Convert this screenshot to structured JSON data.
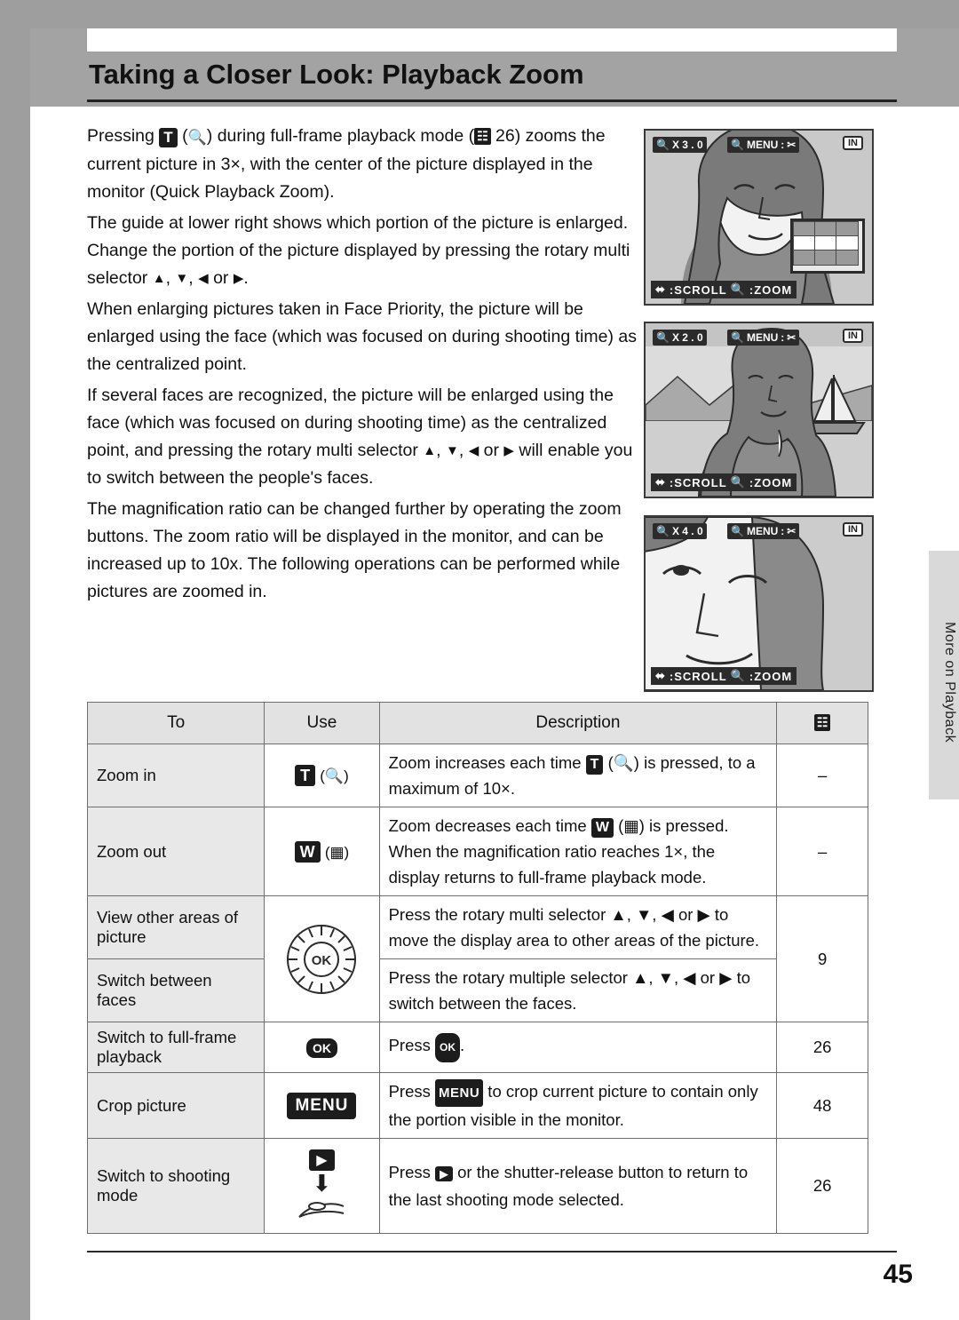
{
  "header": {
    "title": "Taking a Closer Look: Playback Zoom"
  },
  "body": {
    "paragraphs": [
      {
        "id": "p1",
        "segments": [
          {
            "t": "text",
            "v": "Pressing "
          },
          {
            "t": "key",
            "v": "T"
          },
          {
            "t": "text",
            "v": " ("
          },
          {
            "t": "icon",
            "v": "magnifier-plus-icon"
          },
          {
            "t": "text",
            "v": ") during full-frame playback mode ("
          },
          {
            "t": "icon",
            "v": "book-ref-icon"
          },
          {
            "t": "text",
            "v": " 26) zooms the current picture in 3×, with the center of the picture displayed in the monitor (Quick Playback Zoom)."
          }
        ],
        "plain": "Pressing T ( ) during full-frame playback mode ( 26) zooms the current picture in 3x, with the center of the picture displayed in the monitor (Quick Playback Zoom)."
      },
      {
        "id": "p2",
        "plain": "The guide at lower right shows which portion of the picture is enlarged. Change the portion of the picture displayed by pressing the rotary multi selector ▲, ▼, ◀ or ▶."
      },
      {
        "id": "p3",
        "plain": "When enlarging pictures taken in Face Priority, the picture will be enlarged using the face (which was focused on during shooting time) as the centralized point."
      },
      {
        "id": "p4",
        "plain": "If several faces are recognized, the picture will be enlarged using the face (which was focused on during shooting time) as the centralized point, and pressing the rotary multi selector ▲, ▼, ◀ or ▶ will enable you to switch between the people's faces."
      },
      {
        "id": "p5",
        "plain": "The magnification ratio can be changed further by operating the zoom buttons. The zoom ratio will be displayed in the monitor, and can be increased up to 10x. The following operations can be performed while pictures are zoomed in."
      }
    ]
  },
  "screens": [
    {
      "id": "screen-1",
      "zoom_label": "X 3 . 0",
      "menu_label": "MENU",
      "memory_label": "IN",
      "scroll_label": ":SCROLL",
      "zoom_hint_label": ":ZOOM",
      "has_minimap": true,
      "subject": "woman-portrait-closeup"
    },
    {
      "id": "screen-2",
      "zoom_label": "X 2 . 0",
      "menu_label": "MENU",
      "memory_label": "IN",
      "scroll_label": ":SCROLL",
      "zoom_hint_label": ":ZOOM",
      "has_minimap": false,
      "subject": "woman-with-sailboat-background"
    },
    {
      "id": "screen-3",
      "zoom_label": "X 4 . 0",
      "menu_label": "MENU",
      "memory_label": "IN",
      "scroll_label": ":SCROLL",
      "zoom_hint_label": ":ZOOM",
      "has_minimap": false,
      "subject": "woman-face-extreme-closeup"
    }
  ],
  "side_tab": {
    "label": "More on Playback"
  },
  "table": {
    "headers": [
      "To",
      "Use",
      "Description",
      "book-ref-icon"
    ],
    "rows": [
      {
        "to": "Zoom in",
        "use_kind": "key-T-magnifier-plus",
        "use_label": "T",
        "description": "Zoom increases each time T ( ) is pressed, to a maximum of 10×.",
        "page": "–"
      },
      {
        "to": "Zoom out",
        "use_kind": "key-W-magnifier-minus",
        "use_label": "W",
        "description": "Zoom decreases each time W ( ) is pressed. When the magnification ratio reaches 1×, the display returns to full-frame playback mode.",
        "page": "–"
      },
      {
        "to": "View other areas of picture",
        "use_kind": "rotary-multi-selector",
        "use_label": "OK",
        "description": "Press the rotary multi selector ▲, ▼, ◀ or ▶ to move the display area to other areas of the picture.",
        "page": "9"
      },
      {
        "to": "Switch between faces",
        "use_kind": "rotary-multi-selector-shared",
        "use_label": "",
        "description": "Press the rotary multiple selector ▲, ▼, ◀ or ▶ to switch between the faces.",
        "page": ""
      },
      {
        "to": "Switch to full-frame playback",
        "use_kind": "ok-button",
        "use_label": "OK",
        "description": "Press Ⓚ.",
        "page": "26"
      },
      {
        "to": "Crop picture",
        "use_kind": "menu-button",
        "use_label": "MENU",
        "description": "Press MENU to crop current picture to contain only the portion visible in the monitor.",
        "page": "48"
      },
      {
        "to": "Switch to shooting mode",
        "use_kind": "playback-button-shutter",
        "use_label": "▶",
        "description": "Press ▶ or the shutter-release button to return to the last shooting mode selected.",
        "page": "26"
      }
    ]
  },
  "footer": {
    "page_number": "45"
  }
}
